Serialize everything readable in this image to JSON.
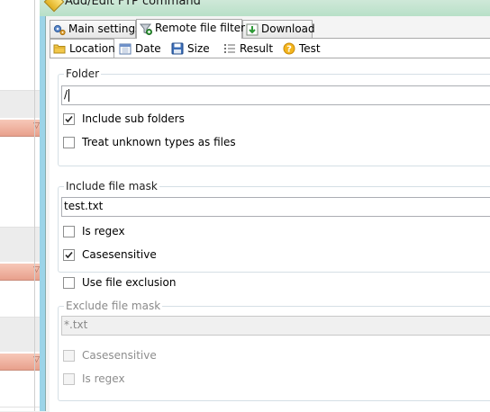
{
  "window": {
    "title": "Add/Edit FTP command"
  },
  "main_tabs": [
    {
      "label": "Main settings",
      "icon": "gear-icon"
    },
    {
      "label": "Remote file filter",
      "icon": "filter-icon"
    },
    {
      "label": "Download",
      "icon": "download-icon"
    }
  ],
  "sub_tabs": [
    {
      "label": "Location",
      "icon": "folder-icon"
    },
    {
      "label": "Date",
      "icon": "calendar-icon"
    },
    {
      "label": "Size",
      "icon": "disk-icon"
    },
    {
      "label": "Result",
      "icon": "list-icon"
    },
    {
      "label": "Test",
      "icon": "help-icon"
    }
  ],
  "folder": {
    "title": "Folder",
    "value": "/",
    "include_sub_folders": {
      "label": "Include sub folders",
      "checked": true
    },
    "treat_unknown": {
      "label": "Treat unknown types as files",
      "checked": false
    }
  },
  "include_mask": {
    "title": "Include file mask",
    "value": "test.txt",
    "is_regex": {
      "label": "Is regex",
      "checked": false
    },
    "case_sensitive": {
      "label": "Casesensitive",
      "checked": true
    }
  },
  "use_exclusion": {
    "label": "Use file exclusion",
    "checked": false
  },
  "exclude_mask": {
    "title": "Exclude file mask",
    "value": "*.txt",
    "case_sensitive": {
      "label": "Casesensitive",
      "checked": false
    },
    "is_regex": {
      "label": "Is regex",
      "checked": false
    }
  },
  "colors": {
    "accent_header": "#e8a08c",
    "check": "#222222"
  }
}
